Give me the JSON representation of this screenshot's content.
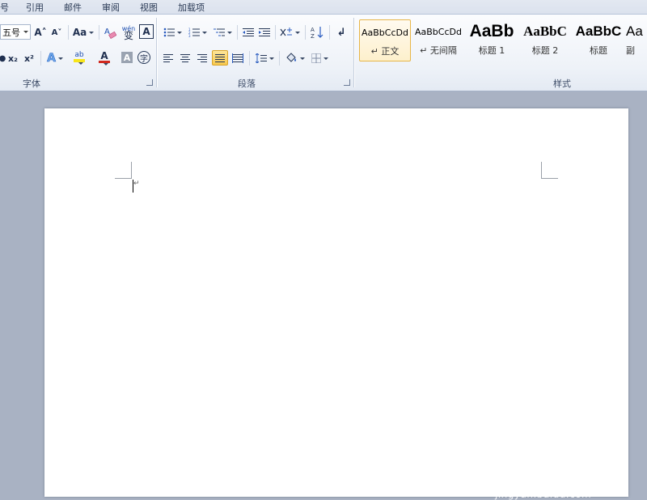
{
  "tabs": [
    "号",
    "引用",
    "邮件",
    "审阅",
    "视图",
    "加载项"
  ],
  "font_group": {
    "font_size_value": "五号",
    "grow_font": "A˄",
    "shrink_font": "A˅",
    "change_case": "Aa",
    "phonetic": "wén",
    "char_border": "A",
    "subscript": "x₂",
    "superscript": "x²",
    "text_effect": "A",
    "highlight": "ab",
    "font_color": "A",
    "char_shading": "A",
    "enclose_char": "字",
    "label": "字体"
  },
  "paragraph_group": {
    "label": "段落"
  },
  "styles_group": {
    "label": "样式",
    "items": [
      {
        "sample": "AaBbCcDd",
        "name": "↵ 正文"
      },
      {
        "sample": "AaBbCcDd",
        "name": "↵ 无间隔"
      },
      {
        "sample": "AaBb",
        "name": "标题 1"
      },
      {
        "sample": "AaBbC",
        "name": "标题 2"
      },
      {
        "sample": "AaBbC",
        "name": "标题"
      },
      {
        "sample": "Aa",
        "name": "副"
      }
    ]
  },
  "document": {
    "text": "",
    "paragraph_mark": "↵"
  },
  "watermark": {
    "brand": "Bai●du 经验",
    "url": "jingyan.baidu.com"
  },
  "colors": {
    "highlight": "#f7e51a",
    "font_color": "#d12a1f",
    "selected_style": "#e7b649"
  }
}
